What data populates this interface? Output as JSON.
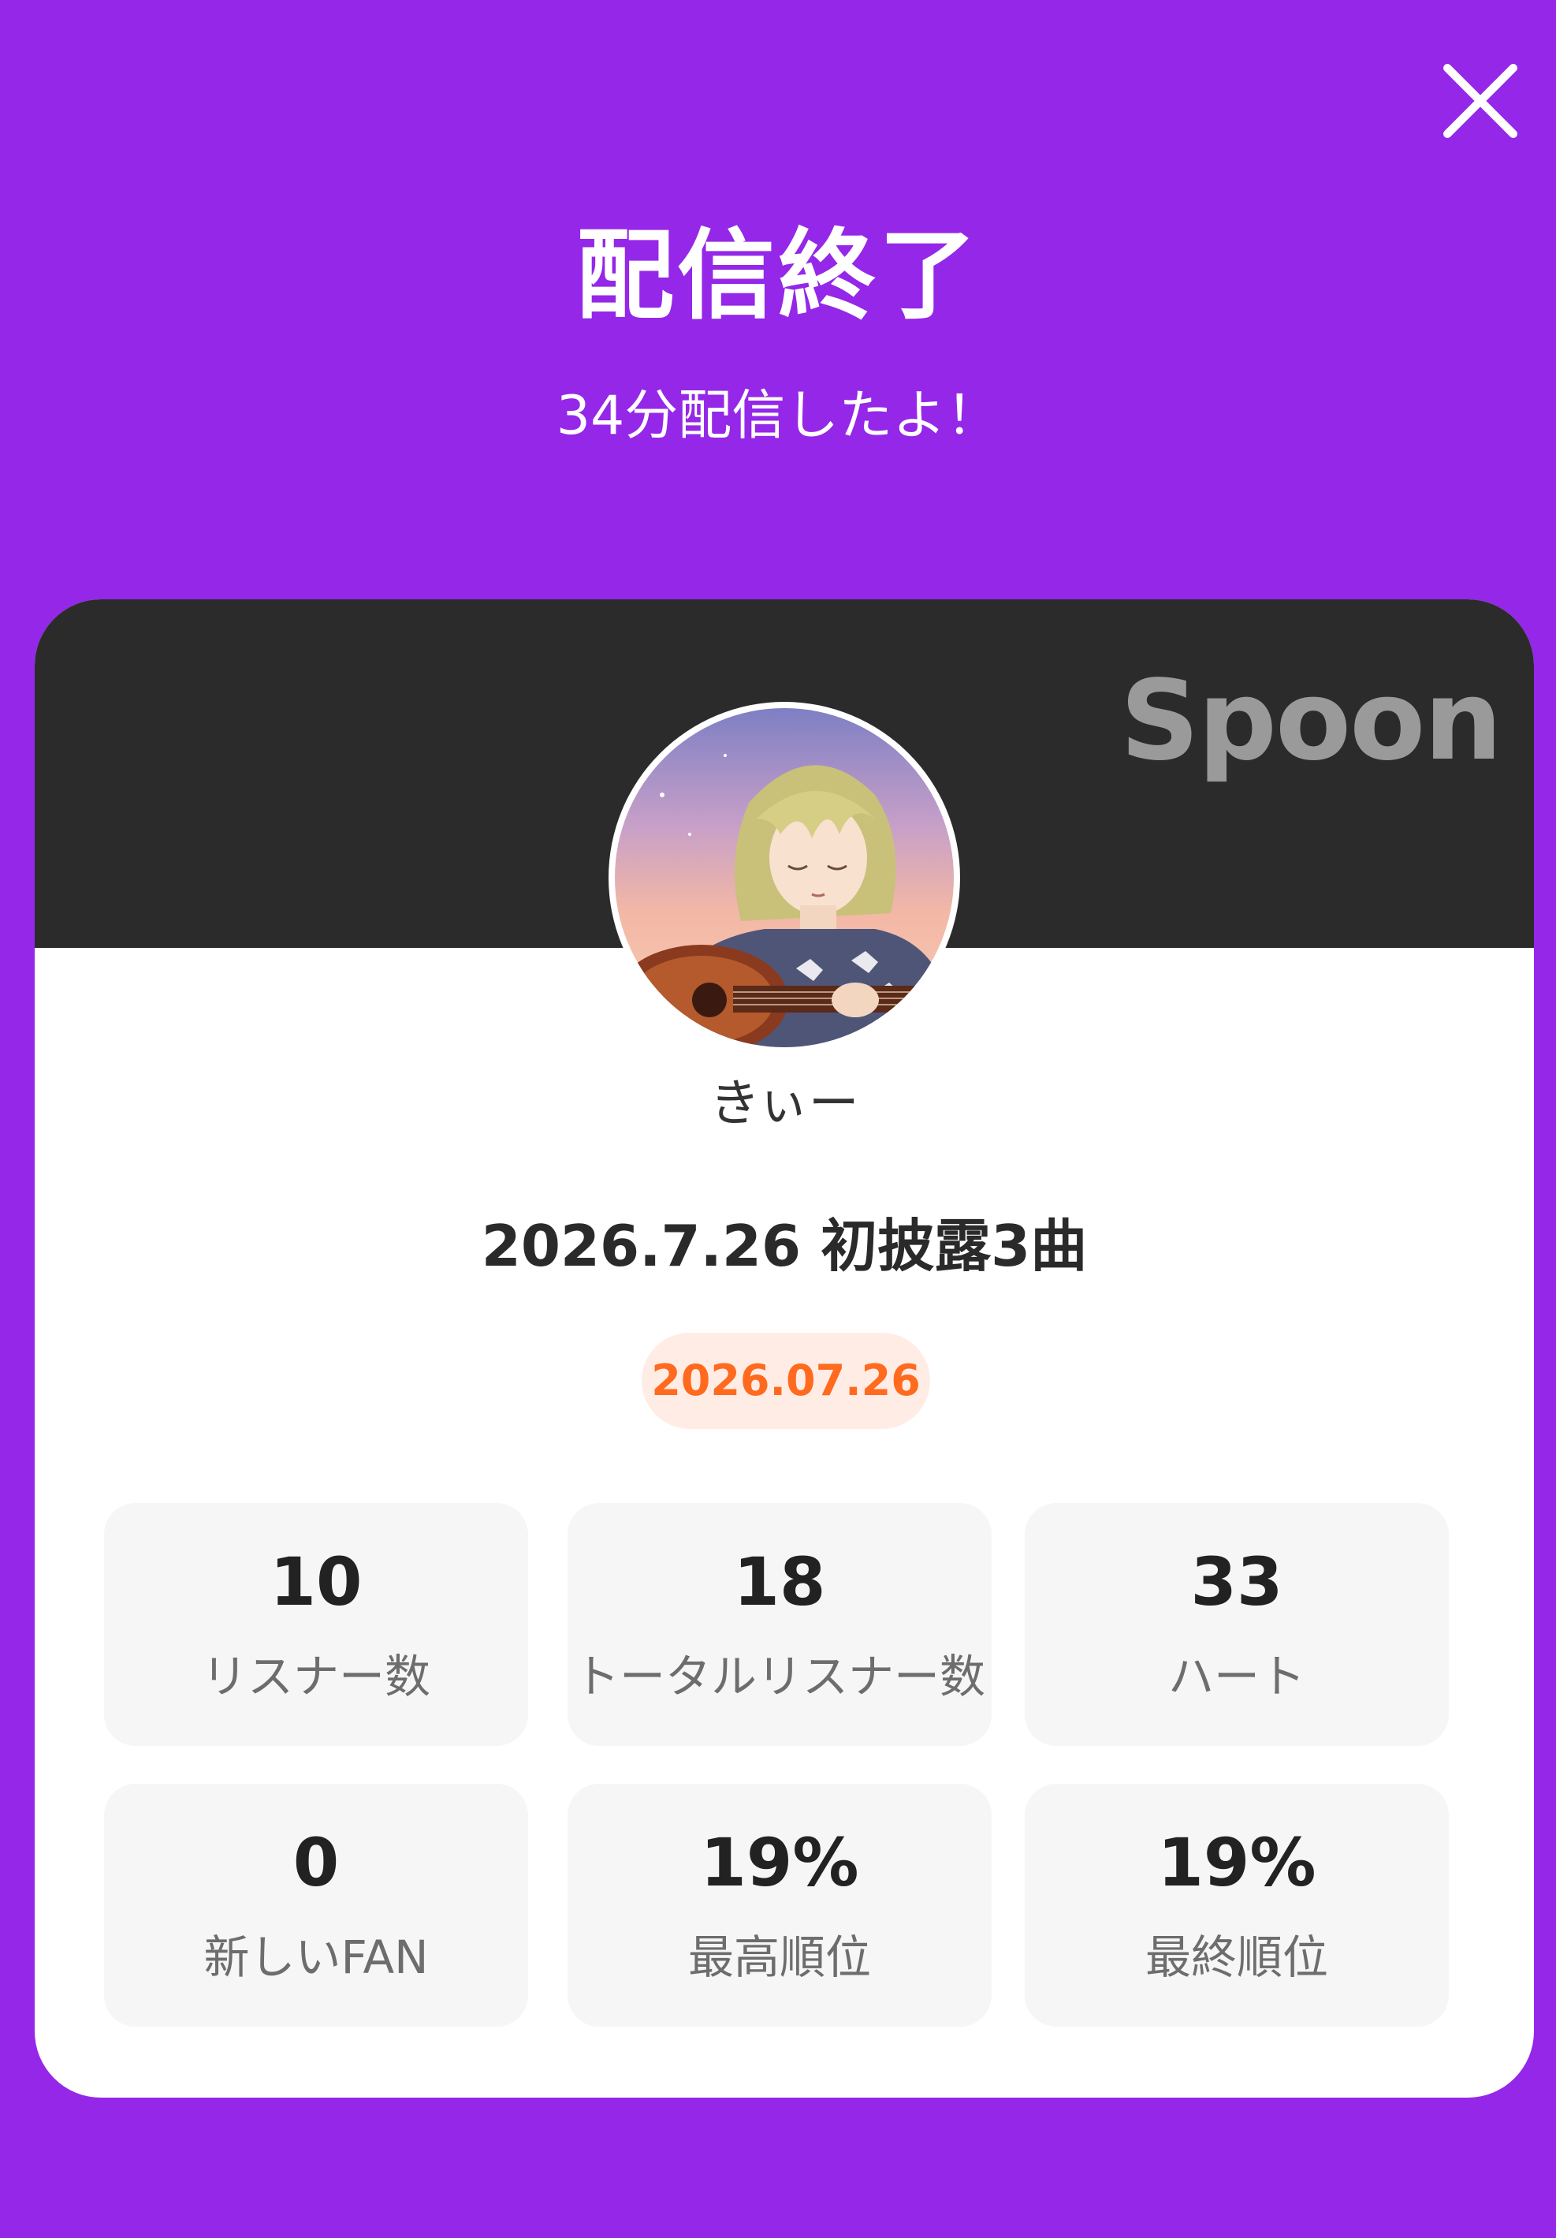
{
  "header": {
    "title": "配信終了",
    "subtitle": "34分配信したよ！",
    "close_icon": "close-icon"
  },
  "card": {
    "brand": "Spoon",
    "avatar_icon": "avatar-illustration",
    "username": "きぃー",
    "broadcast_title": "2026.7.26 初披露3曲",
    "date": "2026.07.26"
  },
  "stats": [
    {
      "value": "10",
      "label": "リスナー数"
    },
    {
      "value": "18",
      "label": "トータルリスナー数"
    },
    {
      "value": "33",
      "label": "ハート"
    },
    {
      "value": "0",
      "label": "新しいFAN"
    },
    {
      "value": "19%",
      "label": "最高順位"
    },
    {
      "value": "19%",
      "label": "最終順位"
    }
  ],
  "colors": {
    "background": "#9527E8",
    "banner": "#2B2B2B",
    "date_badge_bg": "#FFEDE5",
    "date_badge_text": "#FF6A1F",
    "stat_bg": "#F6F6F6"
  }
}
